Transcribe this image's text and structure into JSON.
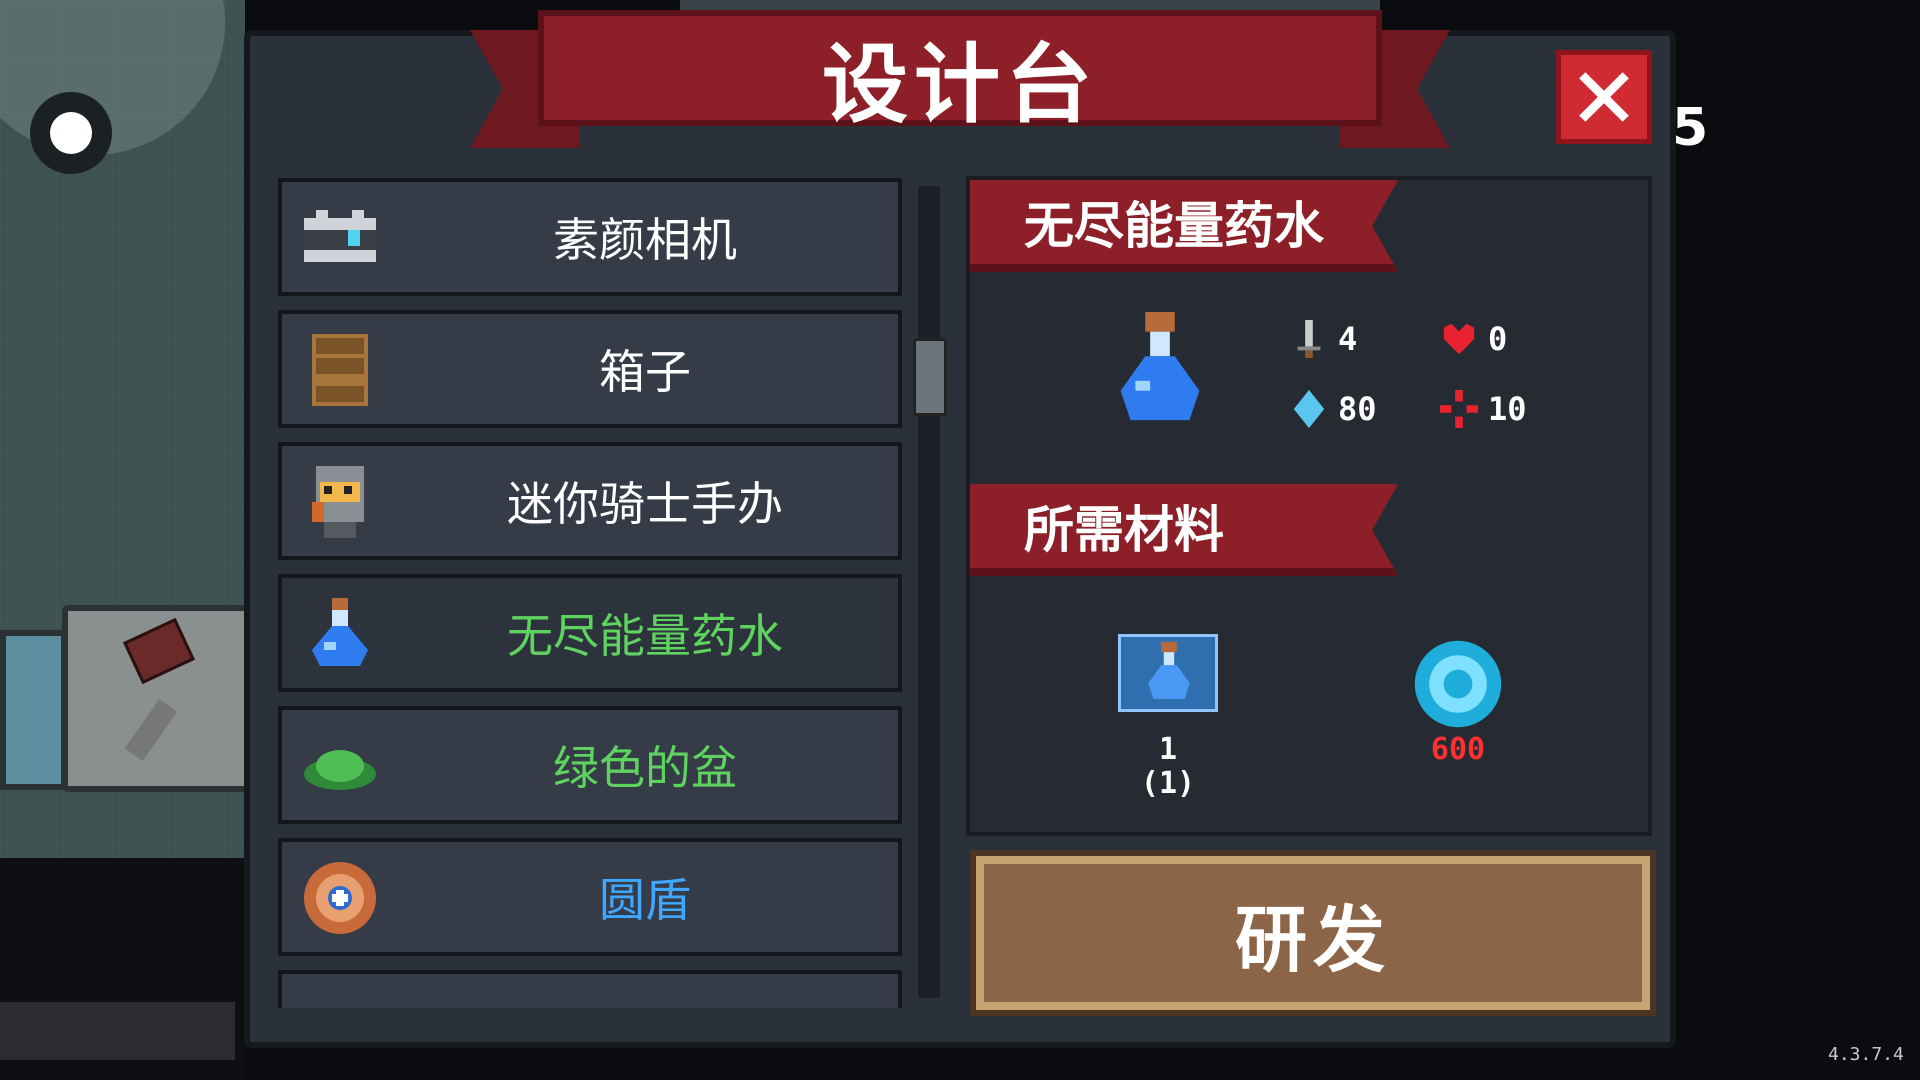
{
  "header": {
    "title": "设计台"
  },
  "close_button": {
    "icon": "close-icon"
  },
  "items": [
    {
      "label": "素颜相机",
      "color": "#ffffff",
      "icon": "camera-icon"
    },
    {
      "label": "箱子",
      "color": "#ffffff",
      "icon": "crate-icon"
    },
    {
      "label": "迷你骑士手办",
      "color": "#ffffff",
      "icon": "knight-figure-icon"
    },
    {
      "label": "无尽能量药水",
      "color": "#5fd35f",
      "icon": "potion-icon",
      "selected": true
    },
    {
      "label": "绿色的盆",
      "color": "#5fd35f",
      "icon": "green-pot-icon"
    },
    {
      "label": "圆盾",
      "color": "#3fa7ff",
      "icon": "round-shield-icon"
    }
  ],
  "detail": {
    "name": "无尽能量药水",
    "stats": {
      "attack": "4",
      "health": "0",
      "energy": "80",
      "crit": "10"
    },
    "materials_title": "所需材料",
    "materials": [
      {
        "icon": "potion-blueprint-icon",
        "required": "1",
        "owned": "(1)"
      },
      {
        "icon": "gem-coin-icon",
        "amount": "600",
        "color": "#ff3030"
      }
    ]
  },
  "research_button": {
    "label": "研发"
  },
  "side_number": "5",
  "version": "4.3.7.4"
}
